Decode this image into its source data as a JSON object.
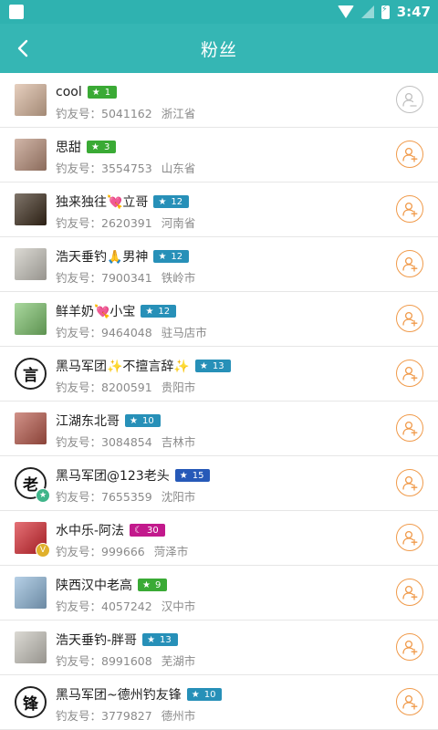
{
  "status_bar": {
    "time": "3:47"
  },
  "header": {
    "title": "粉丝",
    "back_icon": "chevron-left-icon"
  },
  "colors": {
    "header_bg": "#35b6b4",
    "follow_orange": "#f09a4a",
    "followed_gray": "#bfbfbf",
    "badge_green": "#3aaa35",
    "badge_teal": "#2790b8",
    "badge_blue": "#2659b8",
    "badge_magenta": "#c2198c"
  },
  "fans": [
    {
      "name": "cool",
      "level": "1",
      "level_icon": "star",
      "level_color": "#3aaa35",
      "id_label": "钓友号：",
      "id": "5041162",
      "region": "浙江省",
      "avatar_color": "#d9b69c",
      "avatar_text": "",
      "mini_badge": "",
      "followed": true
    },
    {
      "name": "思甜",
      "level": "3",
      "level_icon": "star",
      "level_color": "#3aaa35",
      "id_label": "钓友号：",
      "id": "3554753",
      "region": "山东省",
      "avatar_color": "#b98f7a",
      "avatar_text": "",
      "mini_badge": "",
      "followed": false
    },
    {
      "name": "独来独往💘立哥",
      "level": "12",
      "level_icon": "star",
      "level_color": "#2790b8",
      "id_label": "钓友号：",
      "id": "2620391",
      "region": "河南省",
      "avatar_color": "#3a2a1a",
      "avatar_text": "",
      "mini_badge": "",
      "followed": false
    },
    {
      "name": "浩天垂钓🙏男神",
      "level": "12",
      "level_icon": "star",
      "level_color": "#2790b8",
      "id_label": "钓友号：",
      "id": "7900341",
      "region": "铁岭市",
      "avatar_color": "#c9c6bd",
      "avatar_text": "",
      "mini_badge": "",
      "followed": false
    },
    {
      "name": "鲜羊奶💘小宝",
      "level": "12",
      "level_icon": "star",
      "level_color": "#2790b8",
      "id_label": "钓友号：",
      "id": "9464048",
      "region": "驻马店市",
      "avatar_color": "#7cc36b",
      "avatar_text": "",
      "mini_badge": "",
      "followed": false
    },
    {
      "name": "黑马军团✨不擅言辞✨",
      "level": "13",
      "level_icon": "star",
      "level_color": "#2790b8",
      "id_label": "钓友号：",
      "id": "8200591",
      "region": "贵阳市",
      "avatar_color": "#ffffff",
      "avatar_text": "言",
      "mini_badge": "",
      "followed": false
    },
    {
      "name": "江湖东北哥",
      "level": "10",
      "level_icon": "star",
      "level_color": "#2790b8",
      "id_label": "钓友号：",
      "id": "3084854",
      "region": "吉林市",
      "avatar_color": "#b8584a",
      "avatar_text": "",
      "mini_badge": "",
      "followed": false
    },
    {
      "name": "黑马军团@123老头",
      "level": "15",
      "level_icon": "star",
      "level_color": "#2659b8",
      "id_label": "钓友号：",
      "id": "7655359",
      "region": "沈阳市",
      "avatar_color": "#ffffff",
      "avatar_text": "老",
      "mini_badge": "star",
      "followed": false
    },
    {
      "name": "水中乐-阿法",
      "level": "30",
      "level_icon": "moon",
      "level_color": "#c2198c",
      "id_label": "钓友号：",
      "id": "999666",
      "region": "菏泽市",
      "avatar_color": "#d7262e",
      "avatar_text": "",
      "mini_badge": "V",
      "followed": false
    },
    {
      "name": "陕西汉中老高",
      "level": "9",
      "level_icon": "star",
      "level_color": "#3aaa35",
      "id_label": "钓友号：",
      "id": "4057242",
      "region": "汉中市",
      "avatar_color": "#8fb7d9",
      "avatar_text": "",
      "mini_badge": "",
      "followed": false
    },
    {
      "name": "浩天垂钓-胖哥",
      "level": "13",
      "level_icon": "star",
      "level_color": "#2790b8",
      "id_label": "钓友号：",
      "id": "8991608",
      "region": "芜湖市",
      "avatar_color": "#c9c6bd",
      "avatar_text": "",
      "mini_badge": "",
      "followed": false
    },
    {
      "name": "黑马军团~德州钓友锋",
      "level": "10",
      "level_icon": "star",
      "level_color": "#2790b8",
      "id_label": "钓友号：",
      "id": "3779827",
      "region": "德州市",
      "avatar_color": "#ffffff",
      "avatar_text": "锋",
      "mini_badge": "",
      "followed": false
    }
  ]
}
